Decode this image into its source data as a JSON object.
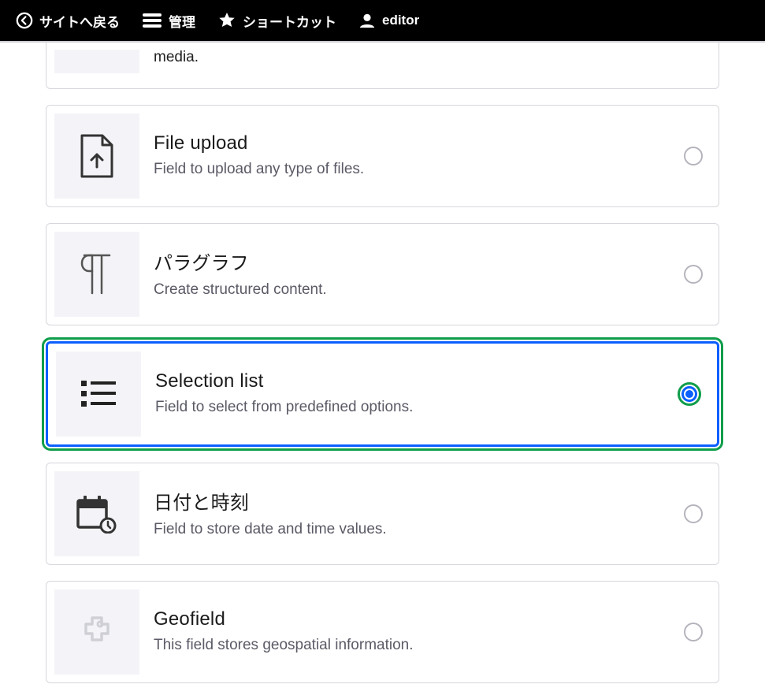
{
  "topbar": {
    "back_label": "サイトへ戻る",
    "manage_label": "管理",
    "shortcut_label": "ショートカット",
    "user_label": "editor"
  },
  "options": {
    "partial": {
      "desc_tail": "media."
    },
    "file_upload": {
      "title": "File upload",
      "desc": "Field to upload any type of files."
    },
    "paragraph": {
      "title": "パラグラフ",
      "desc": "Create structured content."
    },
    "selection_list": {
      "title": "Selection list",
      "desc": "Field to select from predefined options.",
      "selected": true
    },
    "date_time": {
      "title": "日付と時刻",
      "desc": "Field to store date and time values."
    },
    "geofield": {
      "title": "Geofield",
      "desc": "This field stores geospatial information."
    }
  }
}
